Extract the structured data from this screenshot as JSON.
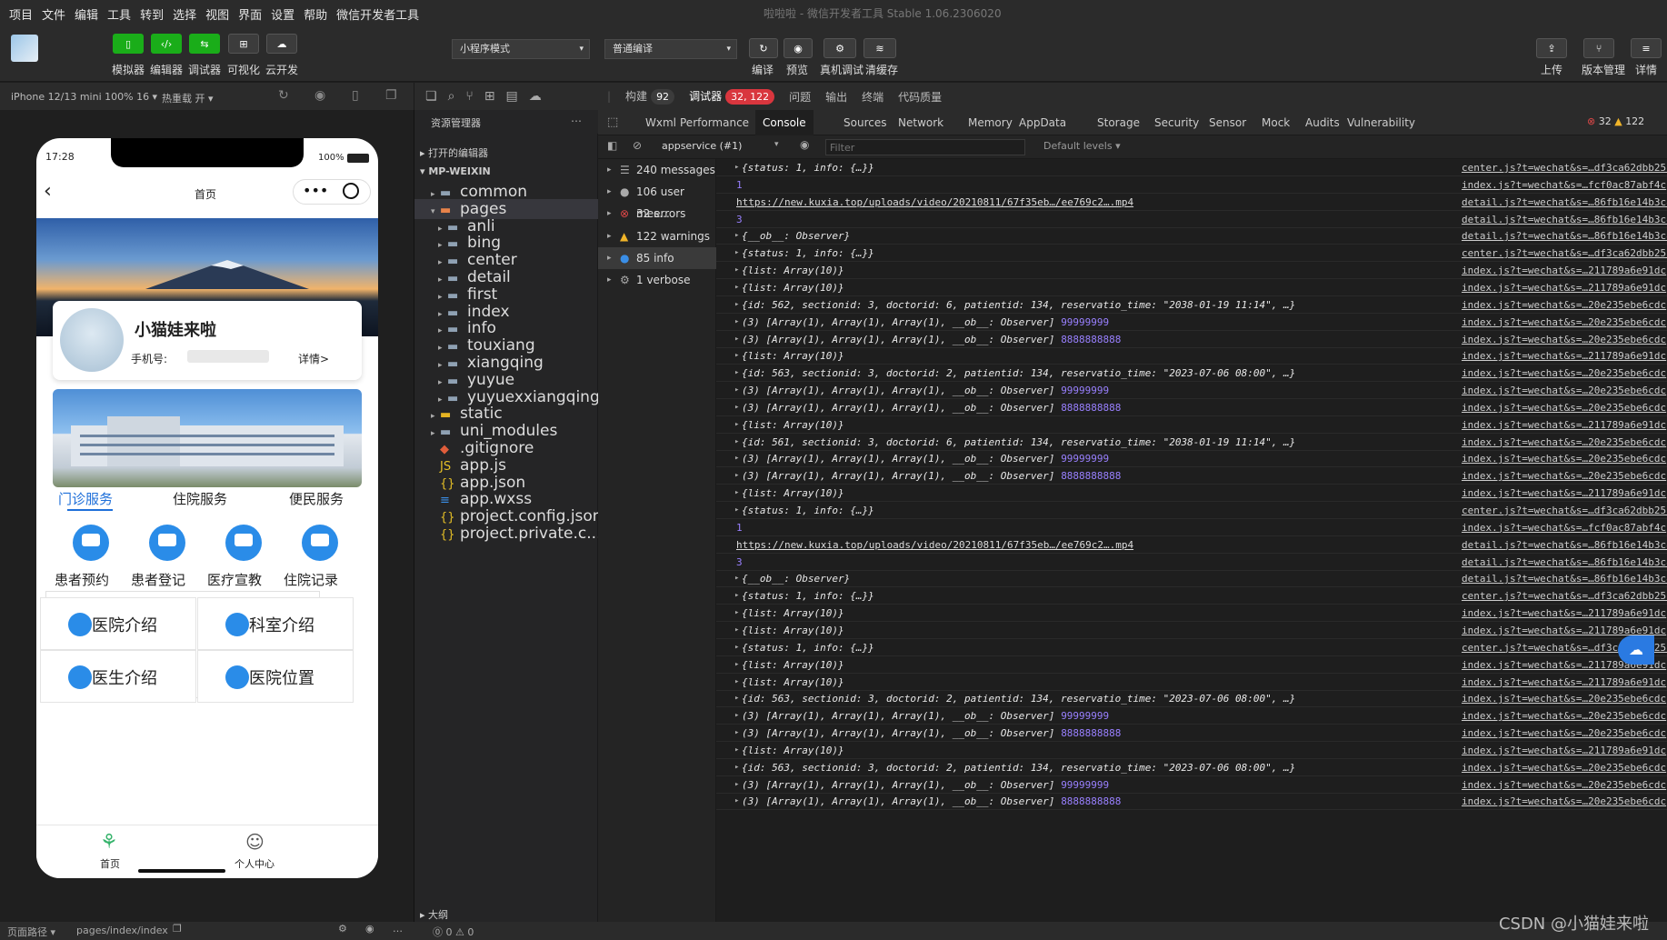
{
  "menu": [
    "项目",
    "文件",
    "编辑",
    "工具",
    "转到",
    "选择",
    "视图",
    "界面",
    "设置",
    "帮助",
    "微信开发者工具"
  ],
  "window_title": "啦啦啦 - 微信开发者工具 Stable 1.06.2306020",
  "toolbar": {
    "left_buttons": [
      {
        "icon": "phone-icon",
        "label": "模拟器"
      },
      {
        "icon": "code-icon",
        "label": "编辑器"
      },
      {
        "icon": "debug-icon",
        "label": "调试器"
      },
      {
        "icon": "layout-icon",
        "label": "可视化"
      },
      {
        "icon": "cloud-icon",
        "label": "云开发"
      }
    ],
    "mode_select": "小程序模式",
    "compile_select": "普通编译",
    "mid_buttons": [
      {
        "icon": "refresh-icon",
        "label": "编译"
      },
      {
        "icon": "eye-icon",
        "label": "预览"
      },
      {
        "icon": "bug-icon",
        "label": "真机调试"
      },
      {
        "icon": "layers-icon",
        "label": "清缓存"
      }
    ],
    "right_buttons": [
      {
        "icon": "upload-icon",
        "label": "上传"
      },
      {
        "icon": "branch-icon",
        "label": "版本管理"
      },
      {
        "icon": "menu-icon",
        "label": "详情"
      }
    ]
  },
  "simulator": {
    "device": "iPhone 12/13 mini 100% 16",
    "hotreload": "热重载 开"
  },
  "phone": {
    "time": "17:28",
    "battery": "100%",
    "nav_title": "首页",
    "user_name": "小猫娃来啦",
    "phone_label": "手机号:",
    "detail_link": "详情>",
    "tabs": [
      "门诊服务",
      "住院服务",
      "便民服务"
    ],
    "services": [
      "患者预约",
      "患者登记",
      "医疗宣教",
      "住院记录"
    ],
    "cards": [
      "医院介绍",
      "科室介绍",
      "医生介绍",
      "医院位置"
    ],
    "tabbar": [
      "首页",
      "个人中心"
    ]
  },
  "explorer": {
    "title": "资源管理器",
    "open_editors": "打开的编辑器",
    "root": "MP-WEIXIN",
    "items": [
      {
        "name": "common",
        "depth": 1,
        "type": "folder",
        "chev": "▸"
      },
      {
        "name": "pages",
        "depth": 1,
        "type": "folder-open",
        "chev": "▾"
      },
      {
        "name": "anli",
        "depth": 2,
        "type": "folder",
        "chev": "▸"
      },
      {
        "name": "bing",
        "depth": 2,
        "type": "folder",
        "chev": "▸"
      },
      {
        "name": "center",
        "depth": 2,
        "type": "folder",
        "chev": "▸"
      },
      {
        "name": "detail",
        "depth": 2,
        "type": "folder",
        "chev": "▸"
      },
      {
        "name": "first",
        "depth": 2,
        "type": "folder",
        "chev": "▸"
      },
      {
        "name": "index",
        "depth": 2,
        "type": "folder",
        "chev": "▸"
      },
      {
        "name": "info",
        "depth": 2,
        "type": "folder",
        "chev": "▸"
      },
      {
        "name": "touxiang",
        "depth": 2,
        "type": "folder",
        "chev": "▸"
      },
      {
        "name": "xiangqing",
        "depth": 2,
        "type": "folder",
        "chev": "▸"
      },
      {
        "name": "yuyue",
        "depth": 2,
        "type": "folder",
        "chev": "▸"
      },
      {
        "name": "yuyuexxiangqing",
        "depth": 2,
        "type": "folder",
        "chev": "▸"
      },
      {
        "name": "static",
        "depth": 1,
        "type": "folder-y",
        "chev": "▸"
      },
      {
        "name": "uni_modules",
        "depth": 1,
        "type": "folder",
        "chev": "▸"
      },
      {
        "name": ".gitignore",
        "depth": 1,
        "type": "git",
        "chev": ""
      },
      {
        "name": "app.js",
        "depth": 1,
        "type": "js",
        "chev": ""
      },
      {
        "name": "app.json",
        "depth": 1,
        "type": "json",
        "chev": ""
      },
      {
        "name": "app.wxss",
        "depth": 1,
        "type": "css",
        "chev": ""
      },
      {
        "name": "project.config.json",
        "depth": 1,
        "type": "json",
        "chev": ""
      },
      {
        "name": "project.private.c...",
        "depth": 1,
        "type": "json",
        "chev": ""
      }
    ],
    "outline": "大纲",
    "status": "⓪ 0 ⚠ 0"
  },
  "devtools": {
    "top_tabs": [
      {
        "label": "构建",
        "badge": "92",
        "badge_color": "#3c3c3c"
      },
      {
        "label": "调试器",
        "badge": "32, 122",
        "badge_color": "#d9363e"
      },
      {
        "label": "问题"
      },
      {
        "label": "输出"
      },
      {
        "label": "终端"
      },
      {
        "label": "代码质量"
      }
    ],
    "tabs": [
      "Wxml",
      "Performance",
      "Console",
      "Sources",
      "Network",
      "Memory",
      "AppData",
      "Storage",
      "Security",
      "Sensor",
      "Mock",
      "Audits",
      "Vulnerability"
    ],
    "active_tab": "Console",
    "error_count": "32",
    "warn_count": "122",
    "context": "appservice (#1)",
    "filter_placeholder": "Filter",
    "levels": "Default levels",
    "sidebar": [
      {
        "icon": "list-icon",
        "label": "240 messages"
      },
      {
        "icon": "user-icon",
        "label": "106 user mes..."
      },
      {
        "icon": "error-icon",
        "label": "32 errors"
      },
      {
        "icon": "warning-icon",
        "label": "122 warnings"
      },
      {
        "icon": "info-icon",
        "label": "85 info"
      },
      {
        "icon": "gear-icon",
        "label": "1 verbose"
      }
    ],
    "rows": [
      {
        "t": "obj",
        "text": "{status: 1, info: {…}}",
        "src": "center.js?t=wechat&s=…df3ca62dbb25c"
      },
      {
        "t": "num",
        "text": "1",
        "src": "index.js?t=wechat&s=…fcf0ac87abf4c"
      },
      {
        "t": "link",
        "text": "https://new.kuxia.top/uploads/video/20210811/67f35eb…/ee769c2….mp4",
        "src": "detail.js?t=wechat&s=…86fb16e14b3c8"
      },
      {
        "t": "num",
        "text": "3",
        "src": "detail.js?t=wechat&s=…86fb16e14b3c8"
      },
      {
        "t": "obj",
        "text": "{__ob__: Observer}",
        "src": "detail.js?t=wechat&s=…86fb16e14b3c8"
      },
      {
        "t": "obj",
        "text": "{status: 1, info: {…}}",
        "src": "center.js?t=wechat&s=…df3ca62dbb25c"
      },
      {
        "t": "obj",
        "text": "{list: Array(10)}",
        "src": "index.js?t=wechat&s=…211789a6e91dc"
      },
      {
        "t": "obj",
        "text": "{list: Array(10)}",
        "src": "index.js?t=wechat&s=…211789a6e91dc"
      },
      {
        "t": "obj",
        "text": "{id: 562, sectionid: 3, doctorid: 6, patientid: 134, reservatio_time: \"2038-01-19 11:14\", …}",
        "src": "index.js?t=wechat&s=…20e235ebe6cdc"
      },
      {
        "t": "arr",
        "text": "(3) [Array(1), Array(1), Array(1), __ob__: Observer]",
        "n": "99999999",
        "src": "index.js?t=wechat&s=…20e235ebe6cdc"
      },
      {
        "t": "arr",
        "text": "(3) [Array(1), Array(1), Array(1), __ob__: Observer]",
        "n": "8888888888",
        "src": "index.js?t=wechat&s=…20e235ebe6cdc"
      },
      {
        "t": "obj",
        "text": "{list: Array(10)}",
        "src": "index.js?t=wechat&s=…211789a6e91dc"
      },
      {
        "t": "obj",
        "text": "{id: 563, sectionid: 3, doctorid: 2, patientid: 134, reservatio_time: \"2023-07-06 08:00\", …}",
        "src": "index.js?t=wechat&s=…20e235ebe6cdc"
      },
      {
        "t": "arr",
        "text": "(3) [Array(1), Array(1), Array(1), __ob__: Observer]",
        "n": "99999999",
        "src": "index.js?t=wechat&s=…20e235ebe6cdc"
      },
      {
        "t": "arr",
        "text": "(3) [Array(1), Array(1), Array(1), __ob__: Observer]",
        "n": "8888888888",
        "src": "index.js?t=wechat&s=…20e235ebe6cdc"
      },
      {
        "t": "obj",
        "text": "{list: Array(10)}",
        "src": "index.js?t=wechat&s=…211789a6e91dc"
      },
      {
        "t": "obj",
        "text": "{id: 561, sectionid: 3, doctorid: 6, patientid: 134, reservatio_time: \"2038-01-19 11:14\", …}",
        "src": "index.js?t=wechat&s=…20e235ebe6cdc"
      },
      {
        "t": "arr",
        "text": "(3) [Array(1), Array(1), Array(1), __ob__: Observer]",
        "n": "99999999",
        "src": "index.js?t=wechat&s=…20e235ebe6cdc"
      },
      {
        "t": "arr",
        "text": "(3) [Array(1), Array(1), Array(1), __ob__: Observer]",
        "n": "8888888888",
        "src": "index.js?t=wechat&s=…20e235ebe6cdc"
      },
      {
        "t": "obj",
        "text": "{list: Array(10)}",
        "src": "index.js?t=wechat&s=…211789a6e91dc"
      },
      {
        "t": "obj",
        "text": "{status: 1, info: {…}}",
        "src": "center.js?t=wechat&s=…df3ca62dbb25c"
      },
      {
        "t": "num",
        "text": "1",
        "src": "index.js?t=wechat&s=…fcf0ac87abf4c"
      },
      {
        "t": "link",
        "text": "https://new.kuxia.top/uploads/video/20210811/67f35eb…/ee769c2….mp4",
        "src": "detail.js?t=wechat&s=…86fb16e14b3c8"
      },
      {
        "t": "num",
        "text": "3",
        "src": "detail.js?t=wechat&s=…86fb16e14b3c8"
      },
      {
        "t": "obj",
        "text": "{__ob__: Observer}",
        "src": "detail.js?t=wechat&s=…86fb16e14b3c8"
      },
      {
        "t": "obj",
        "text": "{status: 1, info: {…}}",
        "src": "center.js?t=wechat&s=…df3ca62dbb25c"
      },
      {
        "t": "obj",
        "text": "{list: Array(10)}",
        "src": "index.js?t=wechat&s=…211789a6e91dc"
      },
      {
        "t": "obj",
        "text": "{list: Array(10)}",
        "src": "index.js?t=wechat&s=…211789a6e91dc"
      },
      {
        "t": "obj",
        "text": "{status: 1, info: {…}}",
        "src": "center.js?t=wechat&s=…df3ca62dbb25c"
      },
      {
        "t": "obj",
        "text": "{list: Array(10)}",
        "src": "index.js?t=wechat&s=…211789a6e91dc"
      },
      {
        "t": "obj",
        "text": "{list: Array(10)}",
        "src": "index.js?t=wechat&s=…211789a6e91dc"
      },
      {
        "t": "obj",
        "text": "{id: 563, sectionid: 3, doctorid: 2, patientid: 134, reservatio_time: \"2023-07-06 08:00\", …}",
        "src": "index.js?t=wechat&s=…20e235ebe6cdc"
      },
      {
        "t": "arr",
        "text": "(3) [Array(1), Array(1), Array(1), __ob__: Observer]",
        "n": "99999999",
        "src": "index.js?t=wechat&s=…20e235ebe6cdc"
      },
      {
        "t": "arr",
        "text": "(3) [Array(1), Array(1), Array(1), __ob__: Observer]",
        "n": "8888888888",
        "src": "index.js?t=wechat&s=…20e235ebe6cdc"
      },
      {
        "t": "obj",
        "text": "{list: Array(10)}",
        "src": "index.js?t=wechat&s=…211789a6e91dc"
      },
      {
        "t": "obj",
        "text": "{id: 563, sectionid: 3, doctorid: 2, patientid: 134, reservatio_time: \"2023-07-06 08:00\", …}",
        "src": "index.js?t=wechat&s=…20e235ebe6cdc"
      },
      {
        "t": "arr",
        "text": "(3) [Array(1), Array(1), Array(1), __ob__: Observer]",
        "n": "99999999",
        "src": "index.js?t=wechat&s=…20e235ebe6cdc"
      },
      {
        "t": "arr",
        "text": "(3) [Array(1), Array(1), Array(1), __ob__: Observer]",
        "n": "8888888888",
        "src": "index.js?t=wechat&s=…20e235ebe6cdc"
      }
    ]
  },
  "statusbar": {
    "path_label": "页面路径",
    "path": "pages/index/index"
  },
  "watermark": "CSDN @小猫娃来啦"
}
